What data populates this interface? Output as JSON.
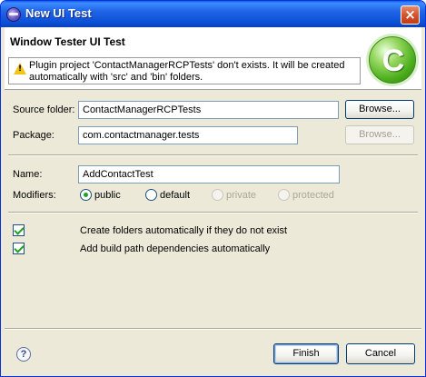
{
  "window": {
    "title": "New UI Test"
  },
  "header": {
    "title": "Window Tester UI Test",
    "message": "Plugin project 'ContactManagerRCPTests' don't exists. It will be created automatically with 'src' and 'bin' folders."
  },
  "form": {
    "source_folder": {
      "label": "Source folder:",
      "value": "ContactManagerRCPTests",
      "browse_label": "Browse..."
    },
    "package": {
      "label": "Package:",
      "value": "com.contactmanager.tests",
      "browse_label": "Browse..."
    },
    "name": {
      "label": "Name:",
      "value": "AddContactTest"
    },
    "modifiers": {
      "label": "Modifiers:",
      "options": [
        {
          "label": "public",
          "checked": true,
          "enabled": true
        },
        {
          "label": "default",
          "checked": false,
          "enabled": true
        },
        {
          "label": "private",
          "checked": false,
          "enabled": false
        },
        {
          "label": "protected",
          "checked": false,
          "enabled": false
        }
      ]
    },
    "create_folders": {
      "label": "Create folders automatically if they do not exist",
      "checked": true
    },
    "add_dependencies": {
      "label": "Add build path dependencies automatically",
      "checked": true
    }
  },
  "footer": {
    "help_glyph": "?",
    "finish_label": "Finish",
    "cancel_label": "Cancel"
  },
  "colors": {
    "titlebar": "#0b4ed5",
    "dialog_bg": "#ece9d8",
    "logo_green": "#4caf1e",
    "check_green": "#21a121"
  },
  "icons": {
    "title": "eclipse-icon",
    "warning": "warning-icon",
    "logo": "wizard-c-logo-icon",
    "help": "help-icon"
  }
}
